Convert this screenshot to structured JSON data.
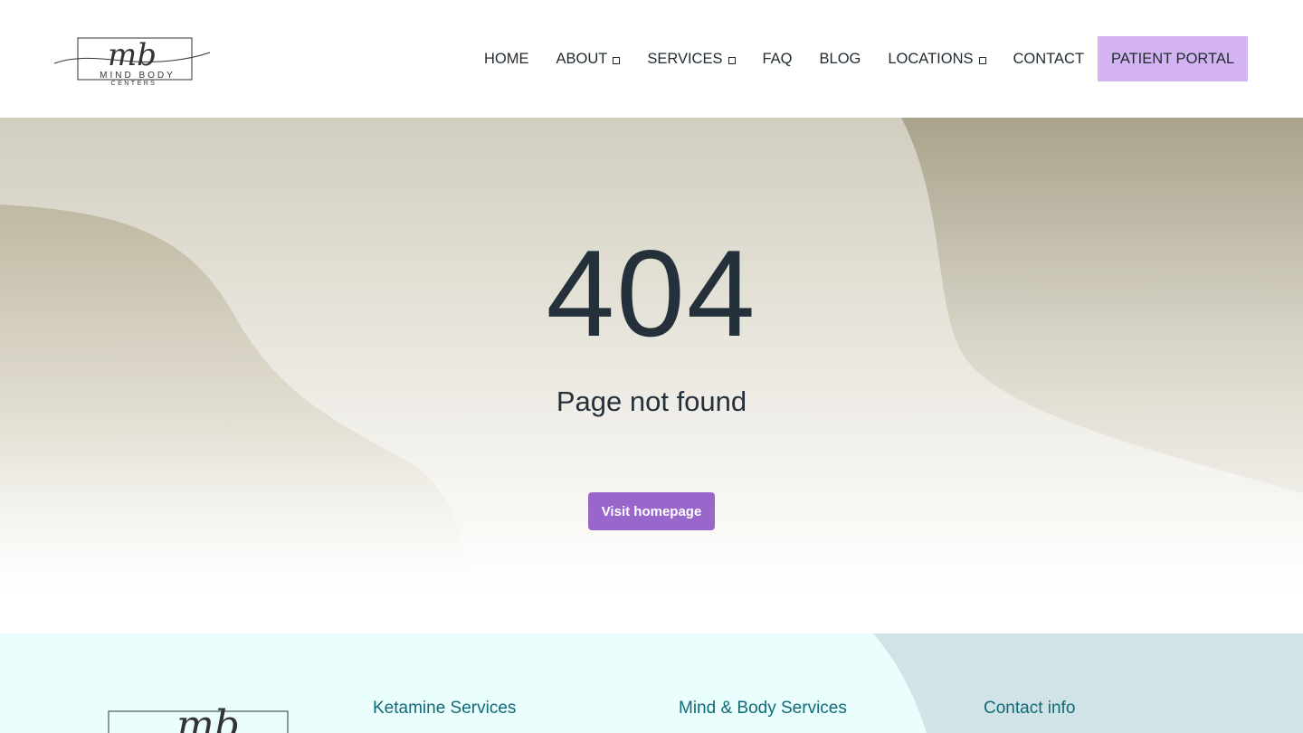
{
  "brand": {
    "monogram": "mb",
    "name": "MIND BODY",
    "sub": "CENTERS"
  },
  "nav": {
    "items": [
      {
        "label": "HOME",
        "dropdown": false
      },
      {
        "label": "ABOUT",
        "dropdown": true
      },
      {
        "label": "SERVICES",
        "dropdown": true
      },
      {
        "label": "FAQ",
        "dropdown": false
      },
      {
        "label": "BLOG",
        "dropdown": false
      },
      {
        "label": "LOCATIONS",
        "dropdown": true
      },
      {
        "label": "CONTACT",
        "dropdown": false
      }
    ],
    "portal_label": "PATIENT PORTAL"
  },
  "error": {
    "code": "404",
    "message": "Page not found",
    "button_label": "Visit homepage"
  },
  "footer": {
    "col1_title": "Ketamine Services",
    "col2_title": "Mind & Body Services",
    "col3_title": "Contact info"
  },
  "colors": {
    "accent": "#9966cc",
    "portal_bg": "#d4b3f2",
    "footer_bg": "#e9fefd",
    "footer_heading": "#116a77",
    "text_dark": "#25313a"
  }
}
